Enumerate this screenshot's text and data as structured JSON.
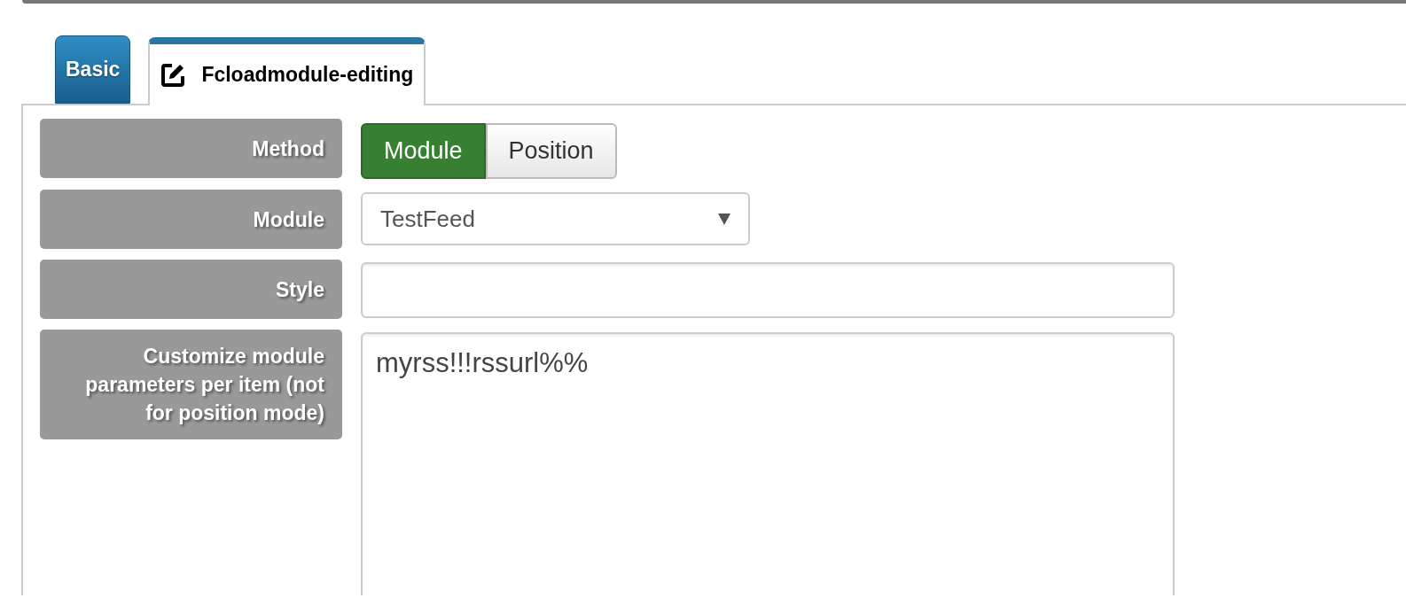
{
  "tabs": [
    {
      "label": "Basic",
      "selected": false,
      "icon": false
    },
    {
      "label": "Fcloadmodule-editing",
      "selected": true,
      "icon": true
    }
  ],
  "fields": [
    {
      "label": "Method",
      "kind": "segmented",
      "options": [
        {
          "label": "Module",
          "selected": true
        },
        {
          "label": "Position",
          "selected": false
        }
      ]
    },
    {
      "label": "Module",
      "kind": "select",
      "value": "TestFeed"
    },
    {
      "label": "Style",
      "kind": "text"
    },
    {
      "label": "Customize module parameters per item (not for position mode)",
      "kind": "textarea",
      "value": "myrss!!!rssurl%%"
    }
  ]
}
